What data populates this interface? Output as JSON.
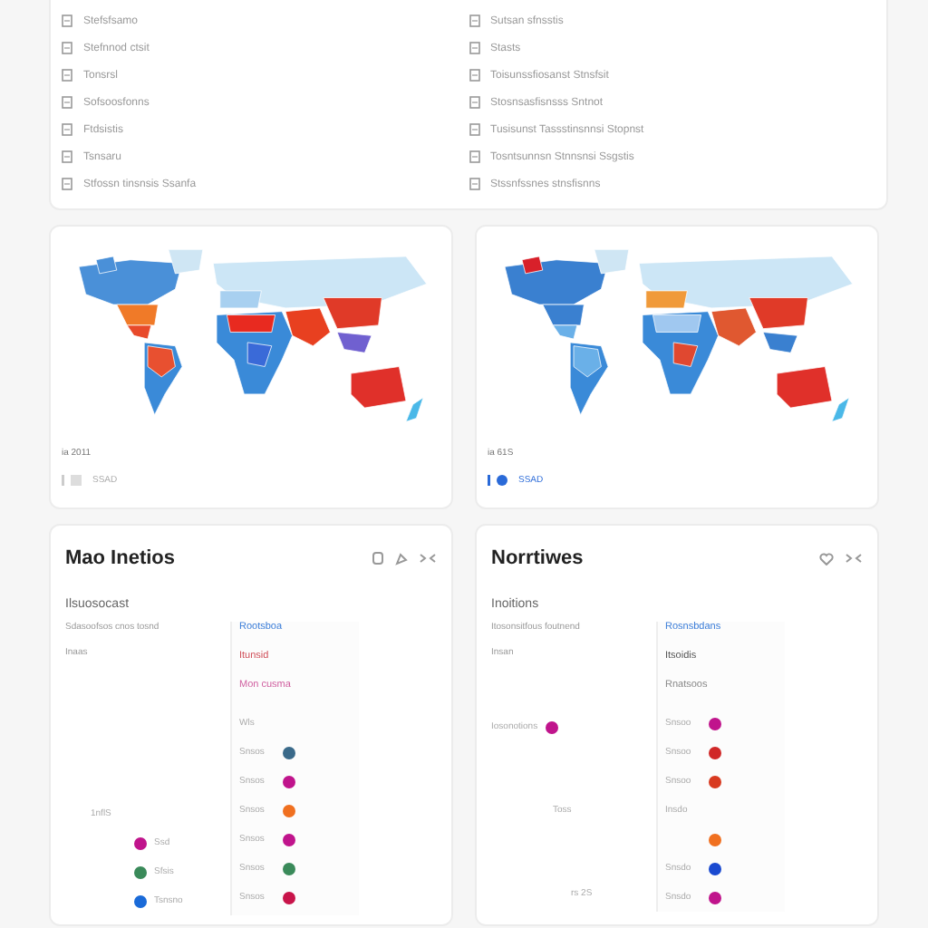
{
  "link_list": {
    "columns": [
      [
        "Stefsfsamo",
        "Stefnnod ctsit",
        "Tonsrsl",
        "Sofsoosfonns",
        "Ftdsistis",
        "Tsnsaru",
        "Stfossn tinsnsis Ssanfa"
      ],
      [
        "Sutsan sfnsstis",
        "Stasts",
        "Toisunssfiosanst Stnsfsit",
        "Stosnsasfisnsss Sntnot",
        "Tusisunst Tassstinsnnsi Stopnst",
        "Tosntsunnsn Stnnsnsi Ssgstis",
        "Stssnfssnes stnsfisnns"
      ]
    ]
  },
  "map_cards": [
    {
      "caption": "ia 2011",
      "legend": {
        "label": "SSAD",
        "active": false
      }
    },
    {
      "caption": "ia 61S",
      "legend": {
        "label": "SSAD",
        "active": true
      }
    }
  ],
  "panels": [
    {
      "title": "Mao Inetios",
      "icons": [
        {
          "kind": "copy"
        },
        {
          "kind": "share"
        },
        {
          "kind": "collapse"
        }
      ],
      "subtitle": "Ilsuosocast",
      "notes": [
        "Sdasoofsos cnos tosnd",
        "Inaas"
      ],
      "side_items": [
        {
          "text": "Rootsboa",
          "color": "#3b7dd8"
        },
        {
          "text": "Itunsid",
          "color": "#d0505a"
        },
        {
          "text": "Mon cusma",
          "color": "#d060a0"
        }
      ],
      "side_heading": "Wls",
      "side_rows": [
        {
          "label": "Snsos",
          "color": "#3a6a8a"
        },
        {
          "label": "Snsos",
          "color": "#c0148c"
        },
        {
          "label": "Snsos",
          "color": "#f07020"
        },
        {
          "label": "Snsos",
          "color": "#c0148c"
        },
        {
          "label": "Snsos",
          "color": "#3a8a5a"
        },
        {
          "label": "Snsos",
          "color": "#c8144a"
        }
      ],
      "left_heading": {
        "label": "1nflS"
      },
      "left_rows": [
        {
          "label": "Ssd",
          "color": "#c0148c"
        },
        {
          "label": "Sfsis",
          "color": "#3a8a5a"
        },
        {
          "label": "Tsnsno",
          "color": "#1a6ad8"
        }
      ]
    },
    {
      "title": "Norrtiwes",
      "icons": [
        {
          "kind": "heart"
        },
        {
          "kind": "collapse"
        }
      ],
      "subtitle": "Inoitions",
      "notes": [
        "Itosonsitfous foutnend",
        "Insan"
      ],
      "side_items": [
        {
          "text": "Rosnsbdans",
          "color": "#3b7dd8"
        },
        {
          "text": "Itsoidis",
          "color": "#555555"
        },
        {
          "text": "Rnatsoos",
          "color": "#888888"
        }
      ],
      "side_rows": [
        {
          "label": "Snsoo",
          "color": "#c0148c"
        },
        {
          "label": "Snsoo",
          "color": "#d02828"
        },
        {
          "label": "Snsoo",
          "color": "#d83a20"
        },
        {
          "label": "Insdo"
        },
        {
          "color": "#f07020"
        },
        {
          "label": "Snsdo",
          "color": "#1a4ad0"
        },
        {
          "label": "Snsdo",
          "color": "#c0148c"
        }
      ],
      "left_heading": {
        "label": "Iosonotions",
        "color": "#c0148c"
      },
      "left_rows": [
        {
          "label": "Toss"
        },
        {
          "label": "rs 2S"
        }
      ]
    }
  ]
}
